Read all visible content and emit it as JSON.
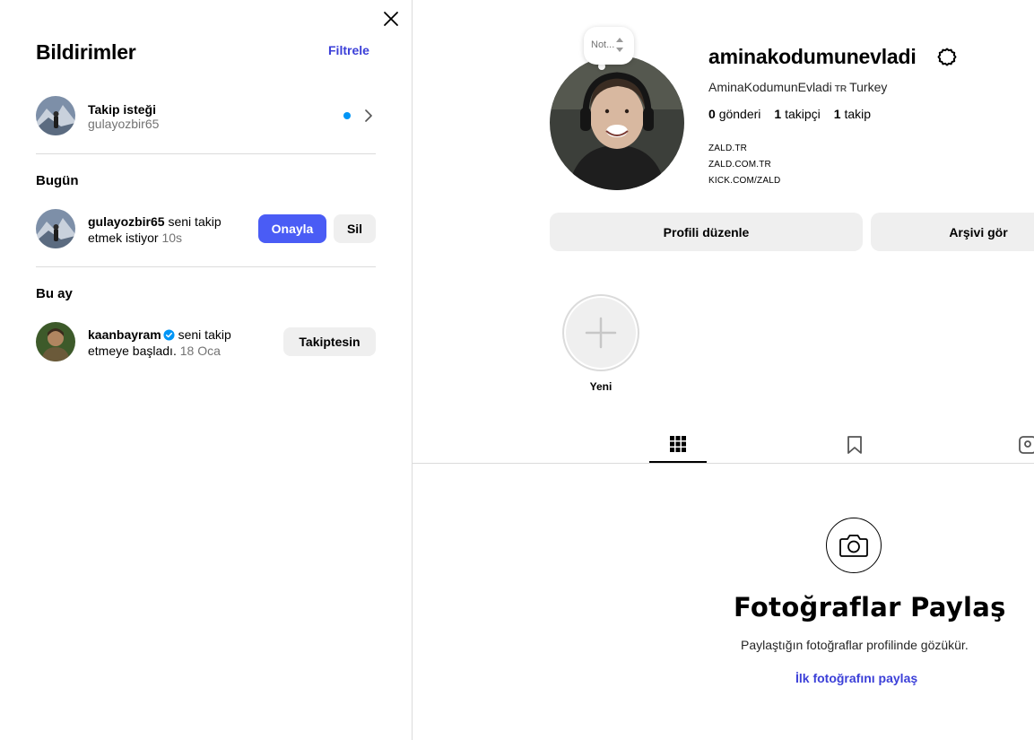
{
  "notifications": {
    "title": "Bildirimler",
    "filter_label": "Filtrele",
    "follow_request": {
      "title": "Takip isteği",
      "username": "gulayozbir65"
    },
    "sections": {
      "today": "Bugün",
      "this_month": "Bu ay"
    },
    "today_item": {
      "username": "gulayozbir65",
      "text_1": " seni takip",
      "text_2": "etmek istiyor ",
      "time": "10s",
      "confirm_label": "Onayla",
      "delete_label": "Sil"
    },
    "month_item": {
      "username": "kaanbayram",
      "text_1": " seni takip",
      "text_2": "etmeye başladı. ",
      "time": "18 Oca",
      "following_label": "Takiptesin"
    }
  },
  "profile": {
    "note_placeholder": "Not...",
    "username": "aminakodumunevladi",
    "full_name": "AminaKodumunEvladi",
    "flag": "TR",
    "country": "Turkey",
    "stats": {
      "posts_num": "0",
      "posts_label": "gönderi",
      "followers_num": "1",
      "followers_label": "takipçi",
      "following_num": "1",
      "following_label": "takip"
    },
    "bio_links": [
      "ZALD.TR",
      "ZALD.COM.TR",
      "KICK.COM/ZALD"
    ],
    "edit_profile_label": "Profili düzenle",
    "archive_label": "Arşivi gör",
    "new_highlight_label": "Yeni",
    "empty": {
      "title": "Fotoğraflar Paylaş",
      "subtitle": "Paylaştığın fotoğraflar profilinde gözükür.",
      "link": "İlk fotoğrafını paylaş"
    }
  },
  "colors": {
    "accent": "#4a5cf5",
    "link": "#3b3fd8",
    "unread_dot": "#0095f6",
    "button_bg": "#efefef"
  }
}
